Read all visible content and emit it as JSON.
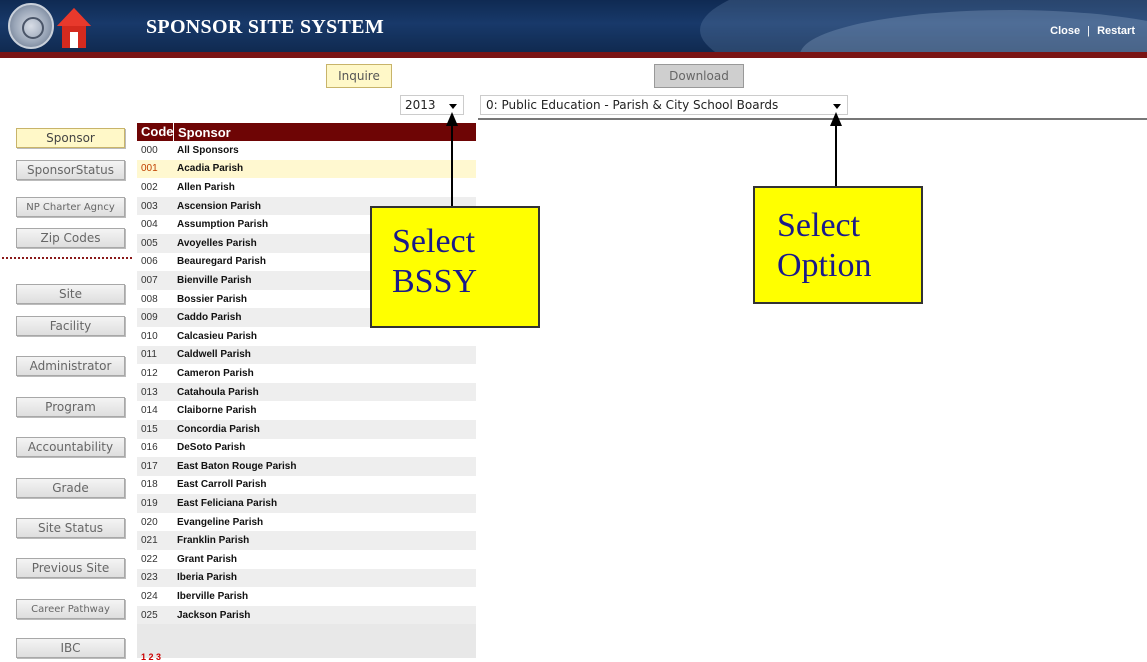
{
  "header": {
    "title": "SPONSOR SITE SYSTEM",
    "close_label": "Close",
    "separator": "|",
    "restart_label": "Restart"
  },
  "toolbar": {
    "inquire_label": "Inquire",
    "download_label": "Download"
  },
  "filters": {
    "year_value": "2013",
    "option_value": "0: Public Education - Parish & City School Boards"
  },
  "sidebar": {
    "items": [
      {
        "label": "Sponsor"
      },
      {
        "label": "SponsorStatus"
      },
      {
        "label": "NP Charter Agncy"
      },
      {
        "label": "Zip Codes"
      },
      {
        "label": "Site"
      },
      {
        "label": "Facility"
      },
      {
        "label": "Administrator"
      },
      {
        "label": "Program"
      },
      {
        "label": "Accountability"
      },
      {
        "label": "Grade"
      },
      {
        "label": "Site Status"
      },
      {
        "label": "Previous Site"
      },
      {
        "label": "Career Pathway"
      },
      {
        "label": "IBC"
      }
    ]
  },
  "table": {
    "columns": [
      "Code",
      "Sponsor"
    ],
    "rows": [
      {
        "code": "000",
        "name": "All Sponsors"
      },
      {
        "code": "001",
        "name": "Acadia Parish"
      },
      {
        "code": "002",
        "name": "Allen Parish"
      },
      {
        "code": "003",
        "name": "Ascension Parish"
      },
      {
        "code": "004",
        "name": "Assumption Parish"
      },
      {
        "code": "005",
        "name": "Avoyelles Parish"
      },
      {
        "code": "006",
        "name": "Beauregard Parish"
      },
      {
        "code": "007",
        "name": "Bienville Parish"
      },
      {
        "code": "008",
        "name": "Bossier Parish"
      },
      {
        "code": "009",
        "name": "Caddo Parish"
      },
      {
        "code": "010",
        "name": "Calcasieu Parish"
      },
      {
        "code": "011",
        "name": "Caldwell Parish"
      },
      {
        "code": "012",
        "name": "Cameron Parish"
      },
      {
        "code": "013",
        "name": "Catahoula Parish"
      },
      {
        "code": "014",
        "name": "Claiborne Parish"
      },
      {
        "code": "015",
        "name": "Concordia Parish"
      },
      {
        "code": "016",
        "name": "DeSoto Parish"
      },
      {
        "code": "017",
        "name": "East Baton Rouge Parish"
      },
      {
        "code": "018",
        "name": "East Carroll Parish"
      },
      {
        "code": "019",
        "name": "East Feliciana Parish"
      },
      {
        "code": "020",
        "name": "Evangeline Parish"
      },
      {
        "code": "021",
        "name": "Franklin Parish"
      },
      {
        "code": "022",
        "name": "Grant Parish"
      },
      {
        "code": "023",
        "name": "Iberia Parish"
      },
      {
        "code": "024",
        "name": "Iberville Parish"
      },
      {
        "code": "025",
        "name": "Jackson Parish"
      }
    ],
    "pager": "1 2 3"
  },
  "annotations": {
    "bssy_line1": "Select",
    "bssy_line2": "BSSY",
    "option_line1": "Select",
    "option_line2": "Option"
  },
  "colors": {
    "header_bg": "#18396a",
    "accent_red": "#7a1414",
    "table_header": "#6e0505",
    "active_button": "#fff8c8",
    "callout": "#ffff00"
  }
}
